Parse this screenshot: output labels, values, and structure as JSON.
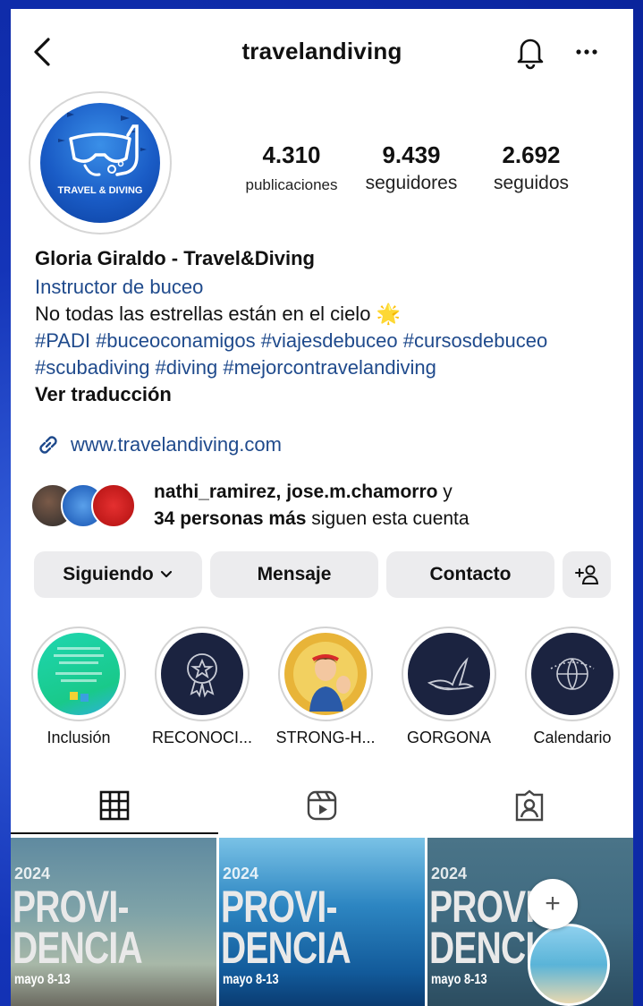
{
  "header": {
    "username": "travelandiving"
  },
  "profile": {
    "avatar_text": "TRAVEL & DIVING",
    "stats": [
      {
        "value": "4.310",
        "label": "publicaciones"
      },
      {
        "value": "9.439",
        "label": "seguidores"
      },
      {
        "value": "2.692",
        "label": "seguidos"
      }
    ],
    "name": "Gloria Giraldo - Travel&Diving",
    "category": "Instructor de buceo",
    "bio_line": "No todas las estrellas están en el cielo 🌟",
    "hashtags_1": "#PADI #buceoconamigos #viajesdebuceo #cursosdebuceo",
    "hashtags_2": "#scubadiving #diving #mejorcontravelandiving",
    "translate": "Ver traducción",
    "website": "www.travelandiving.com"
  },
  "followers": {
    "line1_bold": "nathi_ramirez, jose.m.chamorro",
    "line1_rest": " y",
    "line2_bold": "34 personas más",
    "line2_rest": " siguen esta cuenta"
  },
  "actions": {
    "following": "Siguiendo",
    "message": "Mensaje",
    "contact": "Contacto"
  },
  "highlights": [
    {
      "label": "Inclusión"
    },
    {
      "label": "RECONOCI..."
    },
    {
      "label": "STRONG-H..."
    },
    {
      "label": "GORGONA"
    },
    {
      "label": "Calendario"
    }
  ],
  "posts": [
    {
      "year": "2024",
      "line1": "PROVI-",
      "line2": "DENCIA",
      "date": "mayo 8-13"
    },
    {
      "year": "2024",
      "line1": "PROVI-",
      "line2": "DENCIA",
      "date": "mayo 8-13"
    },
    {
      "year": "2024",
      "line1": "PROVI",
      "line2": "DENCI",
      "date": "mayo 8-13"
    }
  ],
  "colors": {
    "link": "#1f4a8c",
    "button_bg": "#ececee",
    "frame": "#0f2fb0"
  }
}
